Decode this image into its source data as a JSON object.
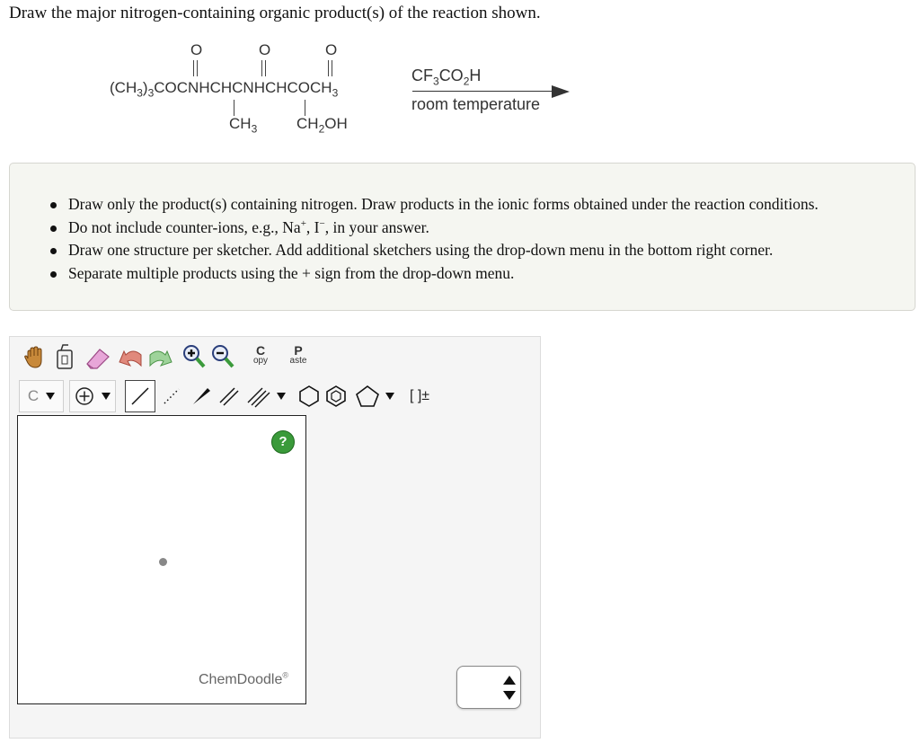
{
  "question": "Draw the major nitrogen-containing organic product(s) of the reaction shown.",
  "reaction": {
    "oxygen": "O",
    "main_chain": "(CH3)3COCNHCHCNHCHCOCH3",
    "sub_left": "CH3",
    "sub_right": "CH2OH",
    "reagent": "CF3CO2H",
    "conditions": "room temperature"
  },
  "instructions": [
    "Draw only the product(s) containing nitrogen. Draw products in the ionic forms obtained under the reaction conditions.",
    "Do not include counter-ions, e.g., Na+, I−, in your answer.",
    "Draw one structure per sketcher. Add additional sketchers using the drop-down menu in the bottom right corner.",
    "Separate multiple products using the + sign from the drop-down menu."
  ],
  "toolbar": {
    "copy_top": "C",
    "copy_bottom": "opy",
    "paste_top": "P",
    "paste_bottom": "aste",
    "atom_label": "C",
    "bracket_label": "[ ]±"
  },
  "sketcher": {
    "help_label": "?",
    "brand": "ChemDoodle",
    "brand_mark": "®"
  },
  "icons": [
    "hand-icon",
    "clear-icon",
    "eraser-icon",
    "undo-icon",
    "redo-icon",
    "zoom-in-icon",
    "zoom-out-icon",
    "charge-icon",
    "single-bond-icon",
    "stereo-bond-icon",
    "wedge-bond-icon",
    "double-bond-icon",
    "triple-bond-icon",
    "cyclohexane-icon",
    "benzene-icon",
    "cyclopentane-icon",
    "dropdown-icon",
    "stepper-icon"
  ]
}
